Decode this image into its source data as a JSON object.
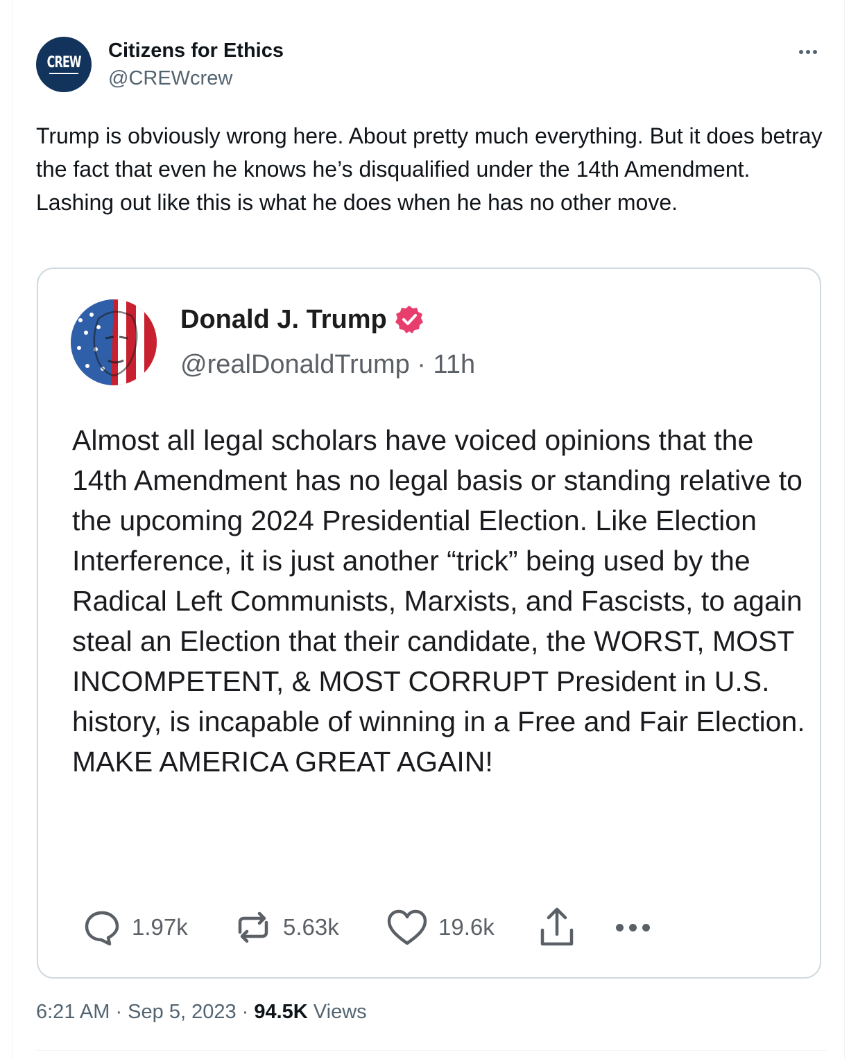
{
  "tweet": {
    "author": {
      "name": "Citizens for Ethics",
      "handle": "@CREWcrew",
      "avatar_text": "CREW",
      "avatar_color": "#12335b"
    },
    "text": "Trump is obviously wrong here. About pretty much everything. But it does betray the fact that even he knows he’s disqualified under the 14th Amendment. Lashing out like this is what he does when he has no other move.",
    "timestamp": "6:21 AM · Sep 5, 2023 · ",
    "views_count": "94.5K",
    "views_label": " Views",
    "more_icon": "ellipsis-icon"
  },
  "quote": {
    "name": "Donald J. Trump",
    "verified_color": "#e83e6e",
    "handle_time": "@realDonaldTrump · 11h",
    "text": "Almost all legal scholars have voiced opinions that the 14th Amendment has no legal basis or standing relative to the upcoming 2024 Presidential Election. Like Election Interference, it is just another “trick” being used by the Radical Left Communists, Marxists, and Fascists, to again steal an Election that their candidate, the WORST, MOST INCOMPETENT, & MOST CORRUPT President in U.S. history, is incapable of winning in a Free and Fair Election. MAKE AMERICA GREAT AGAIN!",
    "actions": {
      "replies": "1.97k",
      "reposts": "5.63k",
      "likes": "19.6k"
    }
  }
}
